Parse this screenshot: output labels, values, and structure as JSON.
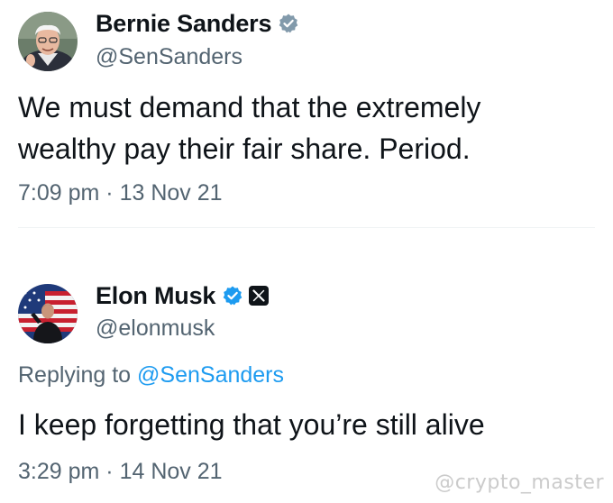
{
  "tweets": [
    {
      "display_name": "Bernie Sanders",
      "handle": "@SenSanders",
      "verified_icon": "verified-badge-gray",
      "text_line1": "We must demand that the extremely",
      "text_line2": "wealthy pay their fair share. Period.",
      "time": "7:09 pm",
      "separator": "·",
      "date": "13 Nov 21"
    },
    {
      "display_name": "Elon Musk",
      "handle": "@elonmusk",
      "verified_icon": "verified-badge-blue",
      "affiliate_icon": "x-logo-badge",
      "replying_prefix": "Replying to",
      "replying_to": "@SenSanders",
      "text_line1": "I keep forgetting that you’re still alive",
      "time": "3:29 pm",
      "separator": "·",
      "date": "14 Nov 21"
    }
  ],
  "watermark": "@crypto_master",
  "colors": {
    "text": "#0f1419",
    "secondary": "#536471",
    "link": "#1d9bf0",
    "verified_blue": "#1d9bf0",
    "verified_gray": "#829aab"
  }
}
